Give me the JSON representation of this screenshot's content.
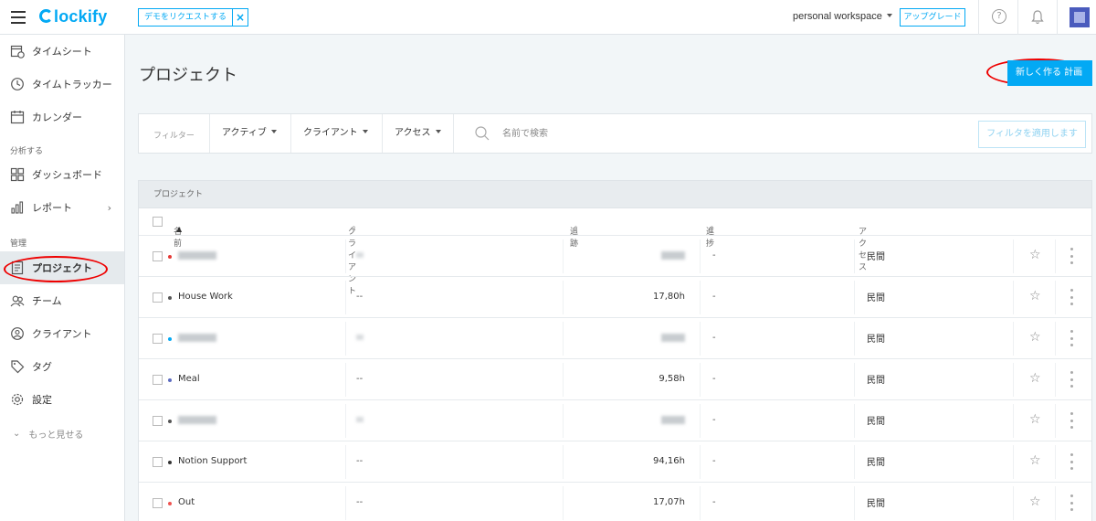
{
  "header": {
    "logo": "lockify",
    "demo_request": "デモをリクエストする",
    "demo_close": "×",
    "workspace": "personal workspace",
    "upgrade": "アップグレード",
    "help": "?"
  },
  "sidebar": {
    "items": [
      {
        "label": "タイムシート",
        "icon": "timesheet-icon"
      },
      {
        "label": "タイムトラッカー",
        "icon": "clock-icon"
      },
      {
        "label": "カレンダー",
        "icon": "calendar-icon"
      },
      {
        "label": "ダッシュボード",
        "icon": "dashboard-icon"
      },
      {
        "label": "レポート",
        "icon": "chart-icon"
      },
      {
        "label": "プロジェクト",
        "icon": "document-icon"
      },
      {
        "label": "チーム",
        "icon": "team-icon"
      },
      {
        "label": "クライアント",
        "icon": "client-icon"
      },
      {
        "label": "タグ",
        "icon": "tag-icon"
      },
      {
        "label": "設定",
        "icon": "gear-icon"
      }
    ],
    "section_analyze": "分析する",
    "section_manage": "管理",
    "show_more": "もっと見せる",
    "active": "プロジェクト"
  },
  "main": {
    "title": "プロジェクト",
    "create_button": "新しく作る 計画",
    "filter": {
      "label": "フィルター",
      "active": "アクティブ",
      "client": "クライアント",
      "access": "アクセス",
      "search_placeholder": "名前で検索",
      "apply": "フィルタを適用します"
    },
    "table": {
      "caption": "プロジェクト",
      "columns": {
        "name": "名前",
        "client": "クライアント",
        "tracked": "追跡",
        "progress": "進捗",
        "access": "アクセス"
      },
      "rows": [
        {
          "name": "",
          "client": "",
          "tracked": "",
          "progress": "-",
          "access": "民間",
          "color": "#e53935",
          "blurred": true
        },
        {
          "name": "House Work",
          "client": "--",
          "tracked": "17,80h",
          "progress": "-",
          "access": "民間",
          "color": "#555555",
          "blurred": false
        },
        {
          "name": "",
          "client": "",
          "tracked": "",
          "progress": "-",
          "access": "民間",
          "color": "#03a9f4",
          "blurred": true
        },
        {
          "name": "Meal",
          "client": "--",
          "tracked": "9,58h",
          "progress": "-",
          "access": "民間",
          "color": "#5c6bc0",
          "blurred": false
        },
        {
          "name": "",
          "client": "",
          "tracked": "",
          "progress": "-",
          "access": "民間",
          "color": "#555555",
          "blurred": true
        },
        {
          "name": "Notion Support",
          "client": "--",
          "tracked": "94,16h",
          "progress": "-",
          "access": "民間",
          "color": "#333333",
          "blurred": false
        },
        {
          "name": "Out",
          "client": "--",
          "tracked": "17,07h",
          "progress": "-",
          "access": "民間",
          "color": "#ef5350",
          "blurred": false
        }
      ]
    }
  },
  "colors": {
    "accent": "#03a9f4",
    "annotation": "#ee0000",
    "background": "#f2f6f8"
  }
}
